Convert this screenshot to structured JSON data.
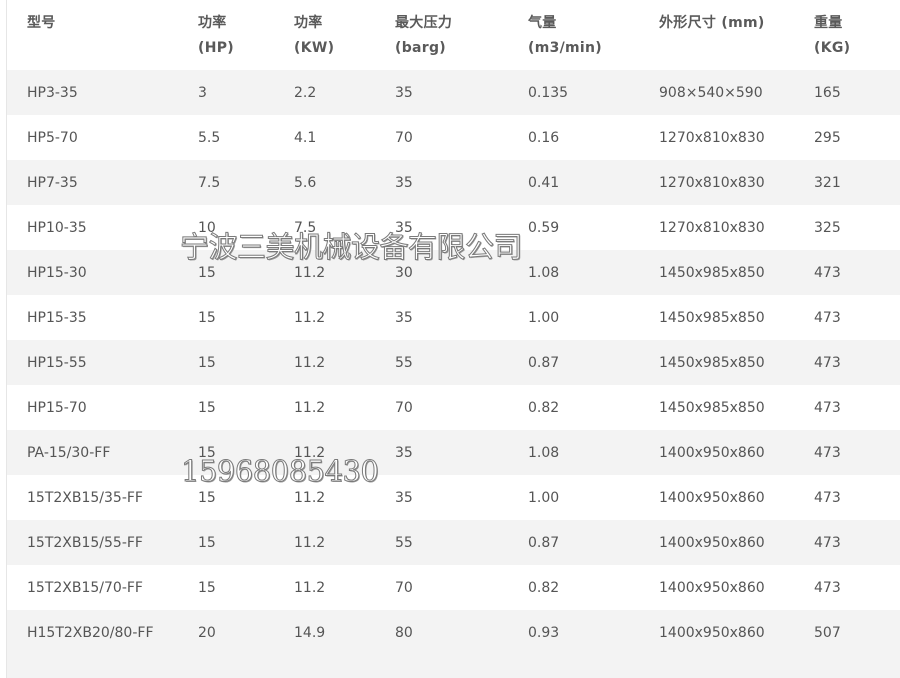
{
  "table": {
    "headers": [
      {
        "line1": "型号",
        "line2": ""
      },
      {
        "line1": "功率",
        "line2": "(HP)"
      },
      {
        "line1": "功率",
        "line2": "(KW)"
      },
      {
        "line1": "最大压力",
        "line2": "(barg)"
      },
      {
        "line1": "气量",
        "line2": "(m3/min)"
      },
      {
        "line1": "外形尺寸 (mm)",
        "line2": ""
      },
      {
        "line1": "重量",
        "line2": "(KG)"
      }
    ],
    "rows": [
      [
        "HP3-35",
        "3",
        "2.2",
        "35",
        "0.135",
        "908×540×590",
        "165"
      ],
      [
        "HP5-70",
        "5.5",
        "4.1",
        "70",
        "0.16",
        "1270x810x830",
        "295"
      ],
      [
        "HP7-35",
        "7.5",
        "5.6",
        "35",
        "0.41",
        "1270x810x830",
        "321"
      ],
      [
        "HP10-35",
        "10",
        "7.5",
        "35",
        "0.59",
        "1270x810x830",
        "325"
      ],
      [
        "HP15-30",
        "15",
        "11.2",
        "30",
        "1.08",
        "1450x985x850",
        "473"
      ],
      [
        "HP15-35",
        "15",
        "11.2",
        "35",
        "1.00",
        "1450x985x850",
        "473"
      ],
      [
        "HP15-55",
        "15",
        "11.2",
        "55",
        "0.87",
        "1450x985x850",
        "473"
      ],
      [
        "HP15-70",
        "15",
        "11.2",
        "70",
        "0.82",
        "1450x985x850",
        "473"
      ],
      [
        "PA-15/30-FF",
        "15",
        "11.2",
        "35",
        "1.08",
        "1400x950x860",
        "473"
      ],
      [
        "15T2XB15/35-FF",
        "15",
        "11.2",
        "35",
        "1.00",
        "1400x950x860",
        "473"
      ],
      [
        "15T2XB15/55-FF",
        "15",
        "11.2",
        "55",
        "0.87",
        "1400x950x860",
        "473"
      ],
      [
        "15T2XB15/70-FF",
        "15",
        "11.2",
        "70",
        "0.82",
        "1400x950x860",
        "473"
      ],
      [
        "H15T2XB20/80-FF",
        "20",
        "14.9",
        "80",
        "0.93",
        "1400x950x860",
        "507"
      ]
    ]
  },
  "watermarks": {
    "company": "宁波三美机械设备有限公司",
    "phone": "15968085430"
  },
  "colors": {
    "stripe": "#f3f3f3",
    "text": "#555555",
    "background": "#ffffff"
  }
}
